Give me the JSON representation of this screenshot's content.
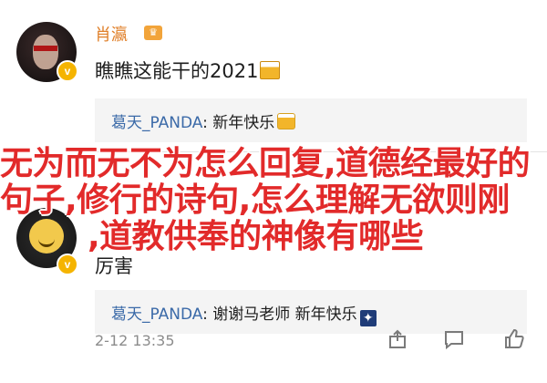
{
  "comments": [
    {
      "username": "肖瀛",
      "text": "瞧瞧这能干的2021",
      "reply": {
        "author": "葛天_PANDA",
        "separator": ": ",
        "text": "新年快乐"
      }
    },
    {
      "username": "",
      "text": "厉害",
      "reply": {
        "author": "葛天_PANDA",
        "separator": ": ",
        "text": "谢谢马老师 新年快乐"
      },
      "time": "2-12 13:35"
    }
  ],
  "overlay": {
    "line1": "无为而无不为怎么回复,道德经最好的",
    "line2": "句子,修行的诗句,怎么理解无欲则刚",
    "line3": ",道教供奉的神像有哪些"
  },
  "badge_symbol": "v",
  "colors": {
    "username": "#e0802a",
    "reply_name": "#3b6aa8",
    "overlay_text": "#e22a2a"
  }
}
